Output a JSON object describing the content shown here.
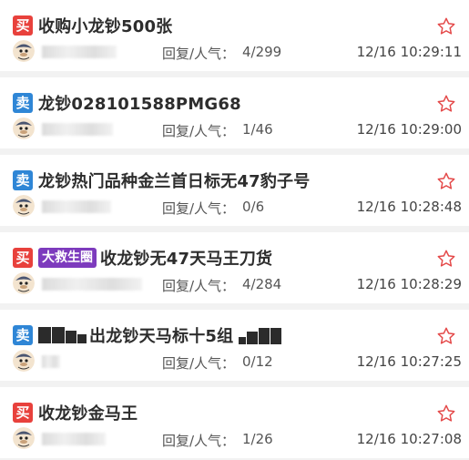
{
  "colors": {
    "buy_badge": "#e8413c",
    "sell_badge": "#2f86d6",
    "tag_purple": "#7d3bbd",
    "star_outline": "#e44848"
  },
  "posts": [
    {
      "type_label": "买",
      "type": "buy",
      "title": "收购小龙钞500张",
      "stats_label": "回复/人气：",
      "stats_value": "4/299",
      "timestamp": "12/16 10:29:11",
      "favorite_icon": "star-outline-icon"
    },
    {
      "type_label": "卖",
      "type": "sell",
      "title": "龙钞028101588PMG68",
      "stats_label": "回复/人气：",
      "stats_value": "1/46",
      "timestamp": "12/16 10:29:00",
      "favorite_icon": "star-outline-icon"
    },
    {
      "type_label": "卖",
      "type": "sell",
      "title": "龙钞热门品种金兰首日标无47豹子号",
      "stats_label": "回复/人气：",
      "stats_value": "0/6",
      "timestamp": "12/16 10:28:48",
      "favorite_icon": "star-outline-icon"
    },
    {
      "type_label": "买",
      "type": "buy",
      "tag": "大救生圈",
      "title": "收龙钞无47天马王刀货",
      "stats_label": "回复/人气：",
      "stats_value": "4/284",
      "timestamp": "12/16 10:28:29",
      "favorite_icon": "star-outline-icon"
    },
    {
      "type_label": "卖",
      "type": "sell",
      "title": "出龙钞天马标十5组",
      "stats_label": "回复/人气：",
      "stats_value": "0/12",
      "timestamp": "12/16 10:27:25",
      "favorite_icon": "star-outline-icon"
    },
    {
      "type_label": "买",
      "type": "buy",
      "title": "收龙钞金马王",
      "stats_label": "回复/人气：",
      "stats_value": "1/26",
      "timestamp": "12/16 10:27:08",
      "favorite_icon": "star-outline-icon"
    }
  ]
}
